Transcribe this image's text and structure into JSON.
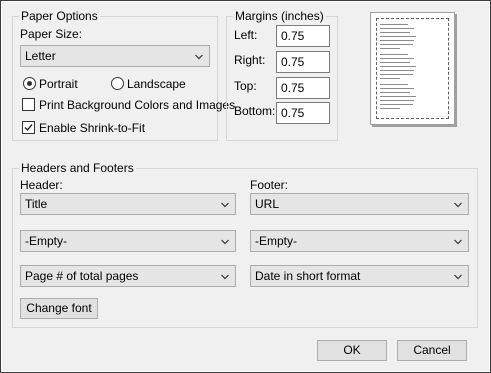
{
  "paper_options": {
    "title": "Paper Options",
    "paper_size_label": "Paper Size:",
    "paper_size_value": "Letter",
    "portrait_label": "Portrait",
    "landscape_label": "Landscape",
    "orientation_selected": "Portrait",
    "print_background_label": "Print Background Colors and Images",
    "print_background_checked": false,
    "shrink_to_fit_label": "Enable Shrink-to-Fit",
    "shrink_to_fit_checked": true
  },
  "margins": {
    "title": "Margins (inches)",
    "left_label": "Left:",
    "left_value": "0.75",
    "right_label": "Right:",
    "right_value": "0.75",
    "top_label": "Top:",
    "top_value": "0.75",
    "bottom_label": "Bottom:",
    "bottom_value": "0.75"
  },
  "headers_footers": {
    "title": "Headers and Footers",
    "header_label": "Header:",
    "footer_label": "Footer:",
    "header_values": [
      "Title",
      "-Empty-",
      "Page # of total pages"
    ],
    "footer_values": [
      "URL",
      "-Empty-",
      "Date in short format"
    ],
    "change_font_label": "Change font"
  },
  "buttons": {
    "ok_label": "OK",
    "cancel_label": "Cancel"
  },
  "icons": {
    "dropdown": "chevron-down-icon"
  }
}
